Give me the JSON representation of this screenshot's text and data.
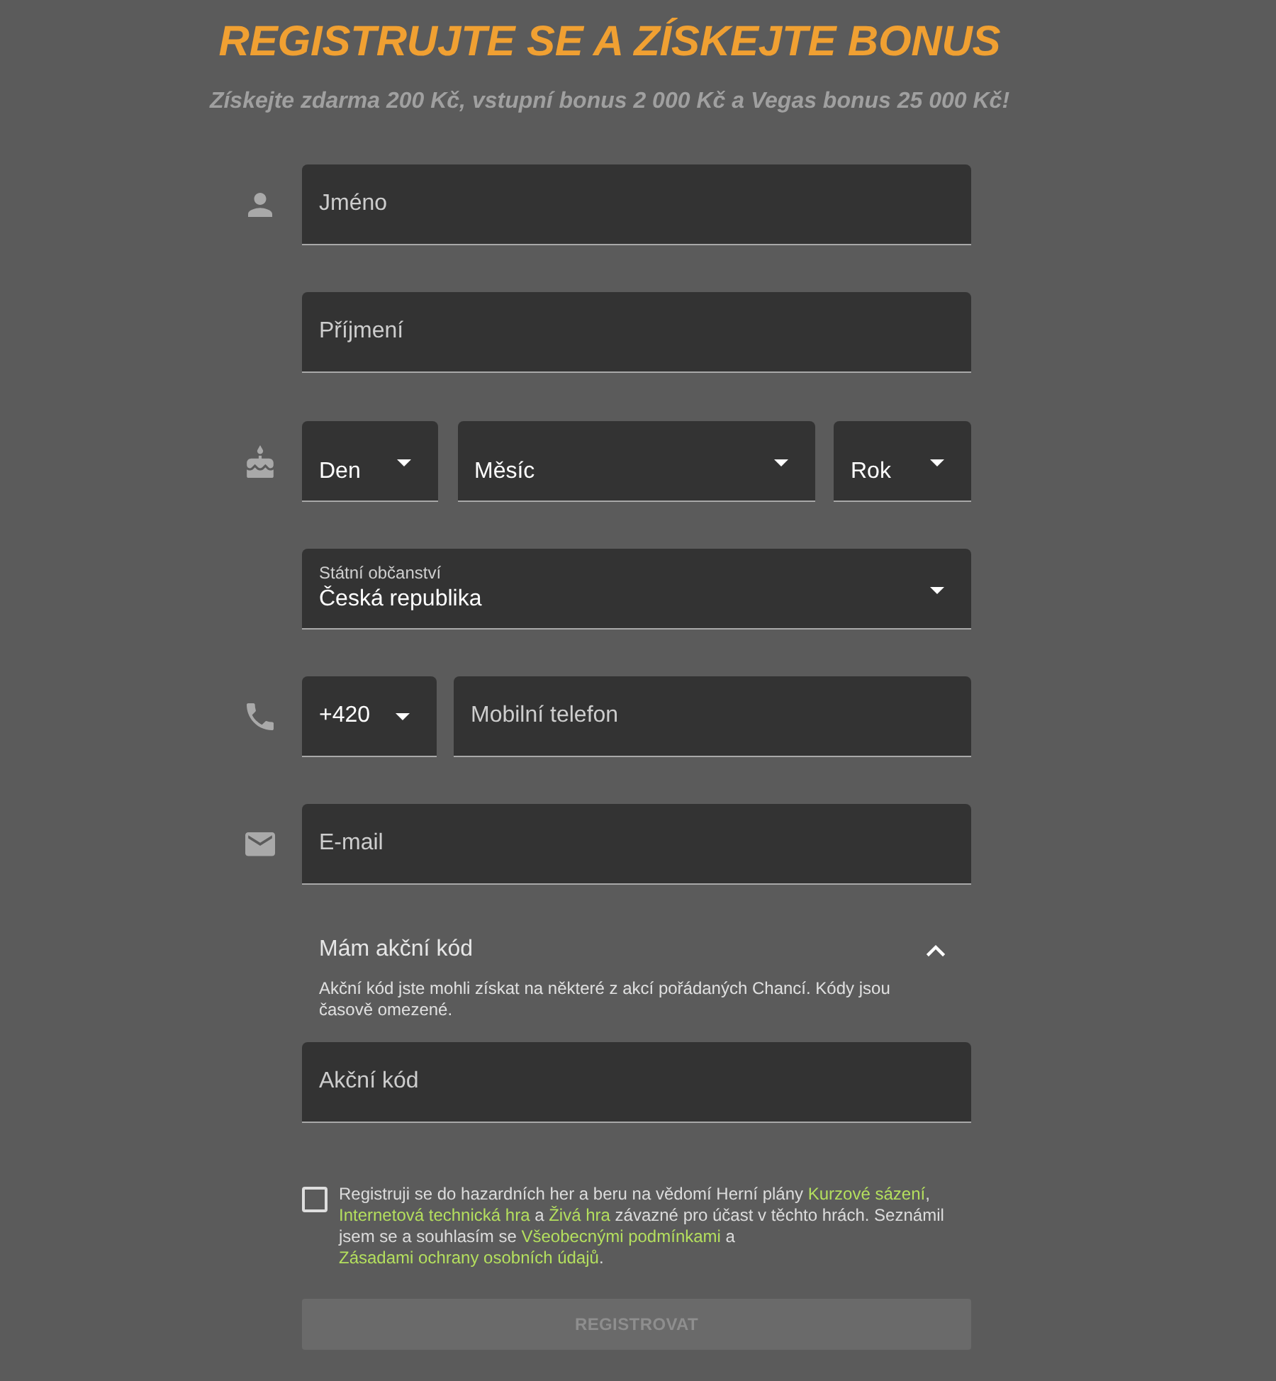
{
  "heading": {
    "title": "REGISTRUJTE SE A ZÍSKEJTE BONUS",
    "subtitle": "Získejte zdarma 200 Kč, vstupní bonus 2 000 Kč a Vegas bonus 25 000 Kč!"
  },
  "form": {
    "first_name": {
      "placeholder": "Jméno"
    },
    "last_name": {
      "placeholder": "Příjmení"
    },
    "birth_date": [
      {
        "label": "Den"
      },
      {
        "label": "Měsíc"
      },
      {
        "label": "Rok"
      }
    ],
    "nationality": {
      "label": "Státní občanství",
      "value": "Česká republika"
    },
    "phone": {
      "prefix": "+420",
      "placeholder": "Mobilní telefon"
    },
    "email": {
      "placeholder": "E-mail"
    },
    "promo": {
      "title": "Mám akční kód",
      "expanded": true,
      "description": "Akční kód jste mohli získat na některé z akcí pořádaných Chancí. Kódy jsou časově omezené.",
      "placeholder": "Akční kód"
    },
    "consent": {
      "checked": false,
      "parts": [
        {
          "kind": "text",
          "text": "Registruji se do hazardních her a beru na vědomí Herní plány "
        },
        {
          "kind": "link",
          "text": "Kurzové sázení"
        },
        {
          "kind": "text",
          "text": ", "
        },
        {
          "kind": "link",
          "text": "Internetová technická hra"
        },
        {
          "kind": "text",
          "text": " a "
        },
        {
          "kind": "link",
          "text": "Živá hra"
        },
        {
          "kind": "text",
          "text": " závazné pro účast v těchto hrách. Seznámil jsem se a souhlasím se "
        },
        {
          "kind": "link",
          "text": "Všeobecnými podmínkami"
        },
        {
          "kind": "text",
          "text": " a "
        },
        {
          "kind": "link",
          "text": "Zásadami ochrany osobních údajů"
        },
        {
          "kind": "text",
          "text": "."
        }
      ]
    },
    "submit": {
      "label": "REGISTROVAT",
      "disabled": true
    }
  }
}
